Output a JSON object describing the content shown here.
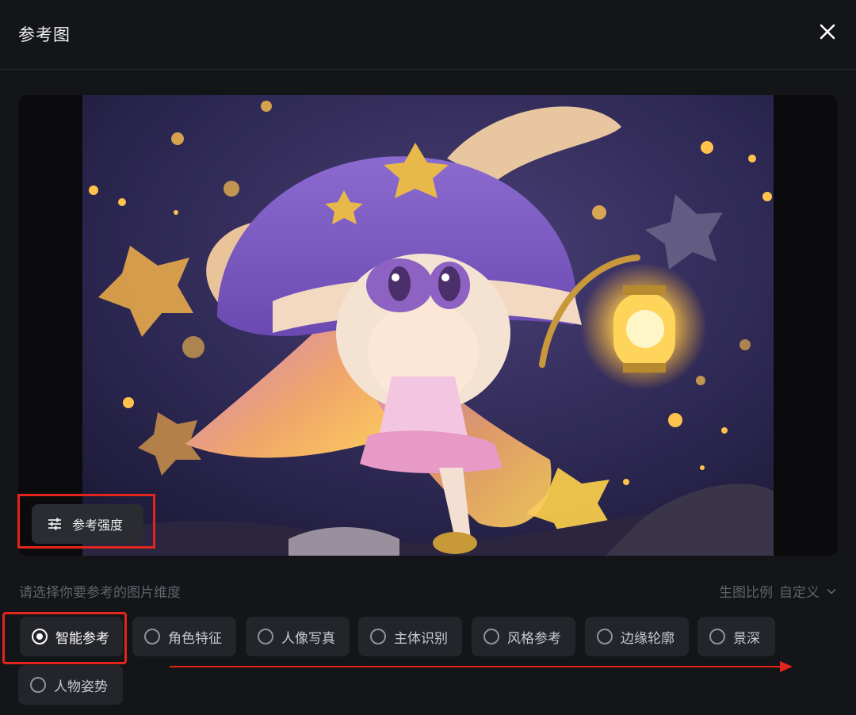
{
  "header": {
    "title": "参考图"
  },
  "preview": {
    "strength_button_label": "参考强度"
  },
  "options_bar": {
    "prompt": "请选择你要参考的图片维度",
    "ratio_label": "生图比例",
    "ratio_value": "自定义"
  },
  "options": [
    {
      "label": "智能参考",
      "selected": true
    },
    {
      "label": "角色特征",
      "selected": false
    },
    {
      "label": "人像写真",
      "selected": false
    },
    {
      "label": "主体识别",
      "selected": false
    },
    {
      "label": "风格参考",
      "selected": false
    },
    {
      "label": "边缘轮廓",
      "selected": false
    },
    {
      "label": "景深",
      "selected": false
    },
    {
      "label": "人物姿势",
      "selected": false
    }
  ],
  "colors": {
    "background": "#141518",
    "chip": "#23252a",
    "highlight": "#e3251b"
  },
  "icons": {
    "close": "close-icon",
    "strength": "sliders-icon",
    "ratio": "chevron-down-icon"
  }
}
